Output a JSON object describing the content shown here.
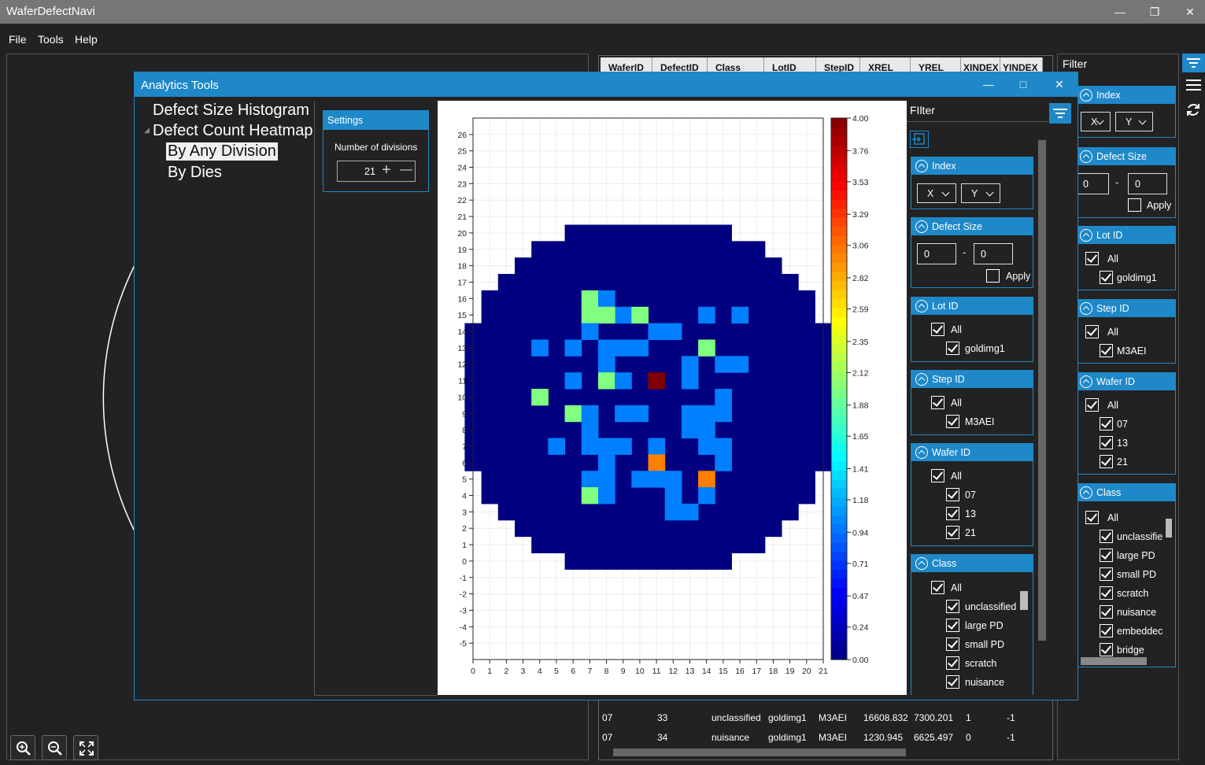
{
  "app": {
    "title": "WaferDefectNavi"
  },
  "menu": {
    "file": "File",
    "tools": "Tools",
    "help": "Help"
  },
  "grid": {
    "headers": [
      "WaferID",
      "DefectID",
      "Class",
      "LotID",
      "StepID",
      "XREL",
      "YREL",
      "XINDEX",
      "YINDEX"
    ],
    "rows": [
      [
        "07",
        "33",
        "unclassified",
        "goldimg1",
        "M3AEI",
        "16608.832",
        "7300.201",
        "1",
        "-1"
      ],
      [
        "07",
        "34",
        "nuisance",
        "goldimg1",
        "M3AEI",
        "1230.945",
        "6625.497",
        "0",
        "-1"
      ]
    ]
  },
  "right_filter": {
    "title": "Filter",
    "index_label": "Index",
    "index_x": "X",
    "index_y": "Y",
    "defect_size_label": "Defect Size",
    "size_min": "0",
    "size_max": "0",
    "size_dash": "-",
    "apply_label": "Apply",
    "lot_label": "Lot ID",
    "lot_items": [
      "All",
      "goldimg1"
    ],
    "step_label": "Step ID",
    "step_items": [
      "All",
      "M3AEI"
    ],
    "wafer_label": "Wafer ID",
    "wafer_items": [
      "All",
      "07",
      "13",
      "21"
    ],
    "class_label": "Class",
    "class_items": [
      "All",
      "unclassifie",
      "large PD",
      "small PD",
      "scratch",
      "nuisance",
      "embeddec",
      "bridge"
    ]
  },
  "dialog": {
    "title": "Analytics Tools",
    "tree": {
      "histogram": "Defect Size Histogram",
      "heatmap": "Defect Count Heatmap",
      "by_any_division": "By Any Division",
      "by_dies": "By Dies"
    },
    "settings": {
      "title": "Settings",
      "divisions_label": "Number of divisions",
      "divisions_value": "21",
      "plus": "+",
      "minus": "—"
    },
    "inner_filter": {
      "title": "FIlter",
      "index_label": "Index",
      "index_x": "X",
      "index_y": "Y",
      "defect_size_label": "Defect Size",
      "size_min": "0",
      "size_max": "0",
      "size_dash": "-",
      "apply_label": "Apply",
      "lot_label": "Lot ID",
      "lot_items": [
        "All",
        "goldimg1"
      ],
      "step_label": "Step ID",
      "step_items": [
        "All",
        "M3AEI"
      ],
      "wafer_label": "Wafer ID",
      "wafer_items": [
        "All",
        "07",
        "13",
        "21"
      ],
      "class_label": "Class",
      "class_items": [
        "All",
        "unclassified",
        "large PD",
        "small PD",
        "scratch",
        "nuisance"
      ]
    }
  },
  "colors": {
    "accent": "#1e88c8",
    "background": "#222222",
    "titlebar": "#767676"
  },
  "chart_data": {
    "type": "heatmap",
    "x_ticks": [
      "0",
      "1",
      "2",
      "3",
      "4",
      "5",
      "6",
      "7",
      "8",
      "9",
      "10",
      "11",
      "12",
      "13",
      "14",
      "15",
      "16",
      "17",
      "18",
      "19",
      "20",
      "21"
    ],
    "y_ticks": [
      "26",
      "25",
      "24",
      "23",
      "22",
      "21",
      "20",
      "19",
      "18",
      "17",
      "16",
      "15",
      "14",
      "13",
      "12",
      "11",
      "10",
      "9",
      "8",
      "7",
      "6",
      "5",
      "4",
      "3",
      "2",
      "1",
      "0",
      "-1",
      "-2",
      "-3",
      "-4",
      "-5"
    ],
    "xlim": [
      0,
      21
    ],
    "ylim": [
      -6,
      27
    ],
    "colorbar_ticks": [
      "4.00",
      "3.76",
      "3.53",
      "3.29",
      "3.06",
      "2.82",
      "2.59",
      "2.35",
      "2.12",
      "1.88",
      "1.65",
      "1.41",
      "1.18",
      "0.94",
      "0.71",
      "0.47",
      "0.24",
      "0.00"
    ],
    "zlim": [
      0,
      4
    ],
    "colormap": "jet",
    "base_value": 0,
    "wafer_rows": [
      {
        "y": 20,
        "x0": 6,
        "x1": 15
      },
      {
        "y": 19,
        "x0": 4,
        "x1": 17
      },
      {
        "y": 18,
        "x0": 3,
        "x1": 18
      },
      {
        "y": 17,
        "x0": 2,
        "x1": 19
      },
      {
        "y": 16,
        "x0": 1,
        "x1": 20
      },
      {
        "y": 15,
        "x0": 1,
        "x1": 20
      },
      {
        "y": 14,
        "x0": 0,
        "x1": 21
      },
      {
        "y": 13,
        "x0": 0,
        "x1": 21
      },
      {
        "y": 12,
        "x0": 0,
        "x1": 21
      },
      {
        "y": 11,
        "x0": 0,
        "x1": 21
      },
      {
        "y": 10,
        "x0": 0,
        "x1": 21
      },
      {
        "y": 9,
        "x0": 0,
        "x1": 21
      },
      {
        "y": 8,
        "x0": 0,
        "x1": 21
      },
      {
        "y": 7,
        "x0": 0,
        "x1": 21
      },
      {
        "y": 6,
        "x0": 0,
        "x1": 21
      },
      {
        "y": 5,
        "x0": 1,
        "x1": 20
      },
      {
        "y": 4,
        "x0": 1,
        "x1": 20
      },
      {
        "y": 3,
        "x0": 2,
        "x1": 19
      },
      {
        "y": 2,
        "x0": 3,
        "x1": 18
      },
      {
        "y": 1,
        "x0": 4,
        "x1": 17
      },
      {
        "y": 0,
        "x0": 6,
        "x1": 15
      }
    ],
    "cells": [
      {
        "x": 7,
        "y": 16,
        "v": 2
      },
      {
        "x": 8,
        "y": 16,
        "v": 1
      },
      {
        "x": 9,
        "y": 15,
        "v": 1
      },
      {
        "x": 7,
        "y": 15,
        "v": 2
      },
      {
        "x": 8,
        "y": 15,
        "v": 2
      },
      {
        "x": 10,
        "y": 15,
        "v": 2
      },
      {
        "x": 14,
        "y": 15,
        "v": 1
      },
      {
        "x": 16,
        "y": 15,
        "v": 1
      },
      {
        "x": 7,
        "y": 14,
        "v": 1
      },
      {
        "x": 11,
        "y": 14,
        "v": 1
      },
      {
        "x": 12,
        "y": 14,
        "v": 1
      },
      {
        "x": 4,
        "y": 13,
        "v": 1
      },
      {
        "x": 6,
        "y": 13,
        "v": 1
      },
      {
        "x": 8,
        "y": 13,
        "v": 1
      },
      {
        "x": 9,
        "y": 13,
        "v": 1
      },
      {
        "x": 10,
        "y": 13,
        "v": 1
      },
      {
        "x": 14,
        "y": 13,
        "v": 2
      },
      {
        "x": 8,
        "y": 12,
        "v": 1
      },
      {
        "x": 13,
        "y": 12,
        "v": 1
      },
      {
        "x": 15,
        "y": 12,
        "v": 1
      },
      {
        "x": 16,
        "y": 12,
        "v": 1
      },
      {
        "x": 6,
        "y": 11,
        "v": 1
      },
      {
        "x": 8,
        "y": 11,
        "v": 2
      },
      {
        "x": 9,
        "y": 11,
        "v": 1
      },
      {
        "x": 11,
        "y": 11,
        "v": 4
      },
      {
        "x": 13,
        "y": 11,
        "v": 1
      },
      {
        "x": 4,
        "y": 10,
        "v": 2
      },
      {
        "x": 15,
        "y": 10,
        "v": 1
      },
      {
        "x": 6,
        "y": 9,
        "v": 2
      },
      {
        "x": 7,
        "y": 9,
        "v": 1
      },
      {
        "x": 9,
        "y": 9,
        "v": 1
      },
      {
        "x": 10,
        "y": 9,
        "v": 1
      },
      {
        "x": 13,
        "y": 9,
        "v": 1
      },
      {
        "x": 14,
        "y": 9,
        "v": 1
      },
      {
        "x": 15,
        "y": 9,
        "v": 1
      },
      {
        "x": 7,
        "y": 8,
        "v": 1
      },
      {
        "x": 13,
        "y": 8,
        "v": 1
      },
      {
        "x": 14,
        "y": 8,
        "v": 1
      },
      {
        "x": 5,
        "y": 7,
        "v": 1
      },
      {
        "x": 7,
        "y": 7,
        "v": 1
      },
      {
        "x": 8,
        "y": 7,
        "v": 1
      },
      {
        "x": 9,
        "y": 7,
        "v": 1
      },
      {
        "x": 11,
        "y": 7,
        "v": 1
      },
      {
        "x": 14,
        "y": 7,
        "v": 1
      },
      {
        "x": 15,
        "y": 7,
        "v": 1
      },
      {
        "x": 8,
        "y": 6,
        "v": 1
      },
      {
        "x": 11,
        "y": 6,
        "v": 3
      },
      {
        "x": 15,
        "y": 6,
        "v": 1
      },
      {
        "x": 7,
        "y": 5,
        "v": 1
      },
      {
        "x": 8,
        "y": 5,
        "v": 1
      },
      {
        "x": 10,
        "y": 5,
        "v": 1
      },
      {
        "x": 11,
        "y": 5,
        "v": 1
      },
      {
        "x": 12,
        "y": 5,
        "v": 1
      },
      {
        "x": 14,
        "y": 5,
        "v": 3
      },
      {
        "x": 7,
        "y": 4,
        "v": 2
      },
      {
        "x": 8,
        "y": 4,
        "v": 1
      },
      {
        "x": 12,
        "y": 4,
        "v": 1
      },
      {
        "x": 14,
        "y": 4,
        "v": 1
      },
      {
        "x": 12,
        "y": 3,
        "v": 1
      },
      {
        "x": 13,
        "y": 3,
        "v": 1
      }
    ]
  }
}
